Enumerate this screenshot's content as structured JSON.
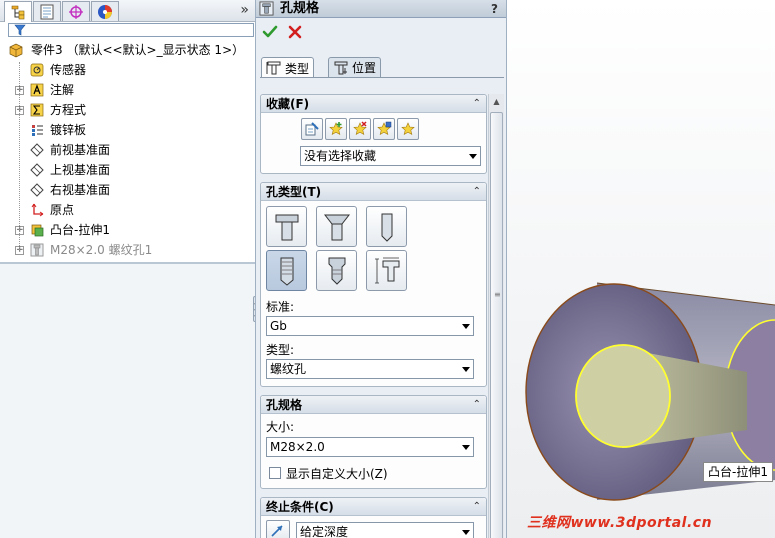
{
  "feature_tree": {
    "tabs": [
      {
        "name": "featuremanager-tab",
        "icon": "feature-tree-icon"
      },
      {
        "name": "propertymanager-tab",
        "icon": "property-icon"
      },
      {
        "name": "configuration-tab",
        "icon": "crosshair-icon"
      },
      {
        "name": "display-tab",
        "icon": "appearance-icon"
      }
    ],
    "expand_glyph": "»",
    "root_label": "零件3 （默认<<默认>_显示状态 1>）",
    "items": [
      {
        "label": "传感器",
        "icon": "sensor-icon",
        "expandable": false
      },
      {
        "label": "注解",
        "icon": "annotation-icon",
        "expandable": true
      },
      {
        "label": "方程式",
        "icon": "equation-icon",
        "expandable": true
      },
      {
        "label": "镀锌板",
        "icon": "material-icon",
        "expandable": false
      },
      {
        "label": "前视基准面",
        "icon": "plane-icon",
        "expandable": false
      },
      {
        "label": "上视基准面",
        "icon": "plane-icon",
        "expandable": false
      },
      {
        "label": "右视基准面",
        "icon": "plane-icon",
        "expandable": false
      },
      {
        "label": "原点",
        "icon": "origin-icon",
        "expandable": false
      },
      {
        "label": "凸台-拉伸1",
        "icon": "extrude-icon",
        "expandable": true
      },
      {
        "label": "M28×2.0 螺纹孔1",
        "icon": "hole-icon",
        "expandable": true,
        "dimmed": true
      }
    ]
  },
  "property_manager": {
    "title": "孔规格",
    "help": "?",
    "tabs": [
      "类型",
      "位置"
    ],
    "favorites": {
      "title": "收藏(F)",
      "select_value": "没有选择收藏"
    },
    "hole_type": {
      "title": "孔类型(T)",
      "standard_label": "标准:",
      "standard_value": "Gb",
      "type_label": "类型:",
      "type_value": "螺纹孔"
    },
    "hole_spec": {
      "title": "孔规格",
      "size_label": "大小:",
      "size_value": "M28×2.0",
      "custom_size_label": "显示自定义大小(Z)",
      "custom_size_checked": false
    },
    "end_condition": {
      "title": "终止条件(C)",
      "value": "给定深度"
    }
  },
  "graphics": {
    "tooltip": "凸台-拉伸1",
    "watermark": "三维网www.3dportal.cn"
  },
  "colors": {
    "accent": "#2d6fb8",
    "ok_green": "#2e9a2e",
    "cancel_red": "#d21e1e",
    "highlight_yellow": "#ffff30",
    "watermark_red": "#e0301e"
  }
}
